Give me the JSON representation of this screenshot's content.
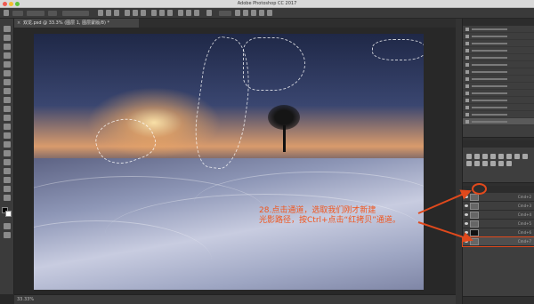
{
  "window": {
    "app_title": "Adobe Photoshop CC 2017"
  },
  "document": {
    "tab_title": "双龙.psd @ 33.3% (图层 1, 图层蒙版/8) *",
    "close_glyph": "×"
  },
  "status": {
    "zoom": "33.33%",
    "doc_size": ""
  },
  "panels": {
    "history": {
      "title": "",
      "items": [
        "",
        "",
        "",
        "",
        "",
        "",
        "",
        "",
        "",
        "",
        "",
        "",
        "",
        ""
      ],
      "selected_index": 13
    },
    "adjustments": {
      "title": "",
      "add_label": ""
    },
    "layers_tabs": [
      "",
      "",
      ""
    ],
    "channels": [
      {
        "label": "",
        "shortcut": "Cmd+2",
        "dark": false
      },
      {
        "label": "",
        "shortcut": "Cmd+3",
        "dark": false
      },
      {
        "label": "",
        "shortcut": "Cmd+4",
        "dark": false
      },
      {
        "label": "",
        "shortcut": "Cmd+5",
        "dark": false
      },
      {
        "label": "",
        "shortcut": "Cmd+6",
        "dark": true
      },
      {
        "label": "",
        "shortcut": "Cmd+7",
        "dark": false
      }
    ]
  },
  "annotation": {
    "line1": "28.点击通道，选取我们刚才新建",
    "line2": "光影路径，按Ctrl+点击“红拷贝”通道。",
    "color": "#f0561f"
  },
  "icons": {
    "eye": "eye-icon"
  }
}
